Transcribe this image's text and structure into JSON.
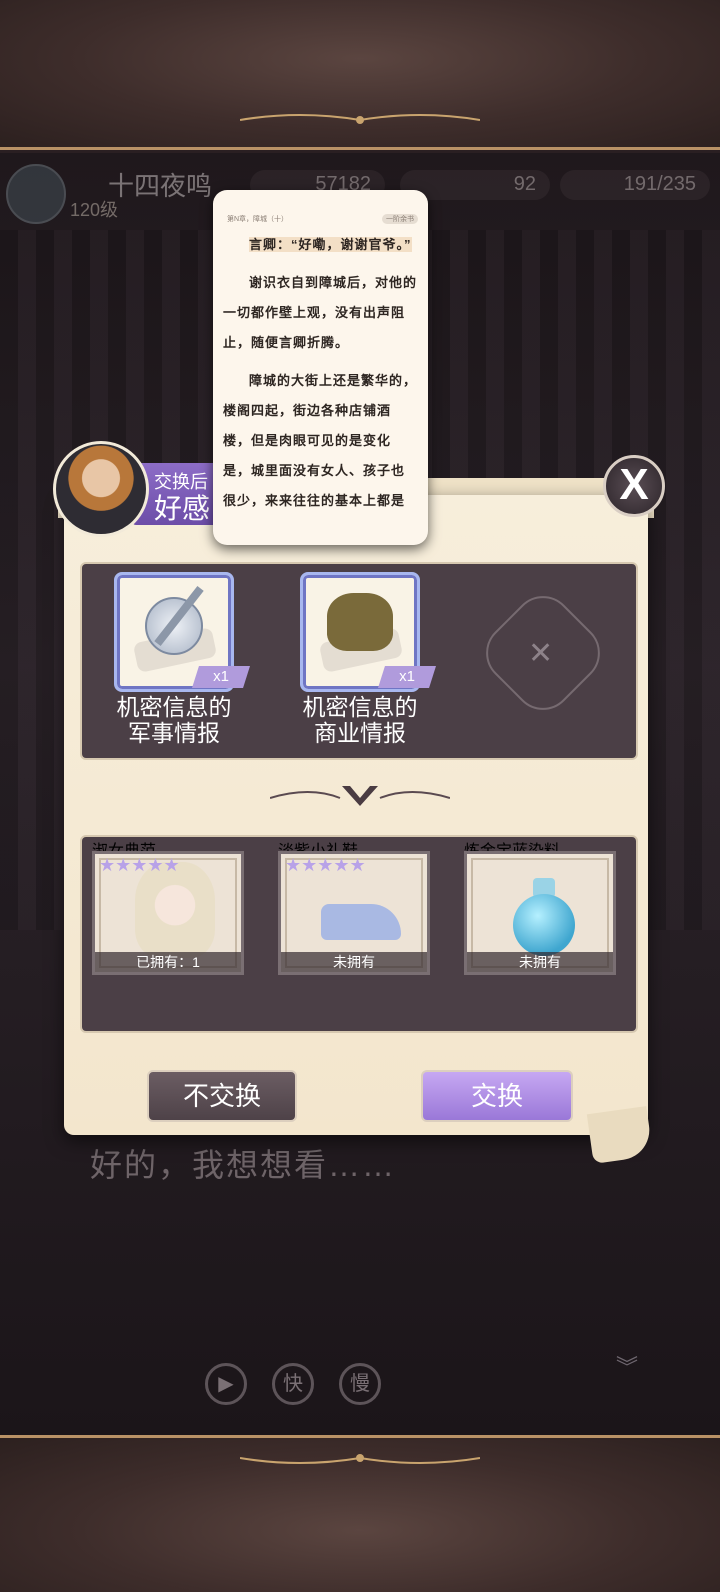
{
  "hud": {
    "player_name": "十四夜鸣",
    "level": "120级",
    "gold": "57182",
    "gems": "92",
    "stamina": "191/235"
  },
  "preview": {
    "meta_left": "第N章，障城（十）",
    "meta_right": "一阶余书",
    "paragraphs": [
      "言卿：“好嘞，谢谢官爷。”",
      "谢识衣自到障城后，对他的一切都作壁上观，没有出声阻止，随便言卿折腾。",
      "障城的大街上还是繁华的，楼阁四起，街边各种店铺酒楼，但是肉眼可见的是变化是，城里面没有女人、孩子也很少，来来往往的基本上都是"
    ]
  },
  "exchange": {
    "tag_line1": "交换后",
    "tag_line2": "好感",
    "give_items": [
      {
        "name_line1": "机密信息的",
        "name_line2": "军事情报",
        "qty": "x1",
        "icon": "military-intel-icon"
      },
      {
        "name_line1": "机密信息的",
        "name_line2": "商业情报",
        "qty": "x1",
        "icon": "business-intel-icon"
      }
    ],
    "get_items": [
      {
        "name": "淑女典范",
        "owned": "已拥有：1",
        "stars": 5,
        "icon": "lady-portrait-icon"
      },
      {
        "name": "淡紫小礼鞋",
        "owned": "未拥有",
        "stars": 5,
        "icon": "shoe-icon"
      },
      {
        "name": "炼金宝蓝染料",
        "owned": "未拥有",
        "stars": 0,
        "icon": "potion-bottle-icon"
      }
    ],
    "decline_label": "不交换",
    "accept_label": "交换",
    "close_label": "X"
  },
  "dialog": {
    "text": "好的，我想想看……"
  },
  "controls": {
    "play": "▶",
    "fast": "快",
    "slow": "慢"
  },
  "colors": {
    "accent_purple": "#9a78d8",
    "panel_paper": "#f5ead3",
    "frame_gold": "#b99266"
  }
}
